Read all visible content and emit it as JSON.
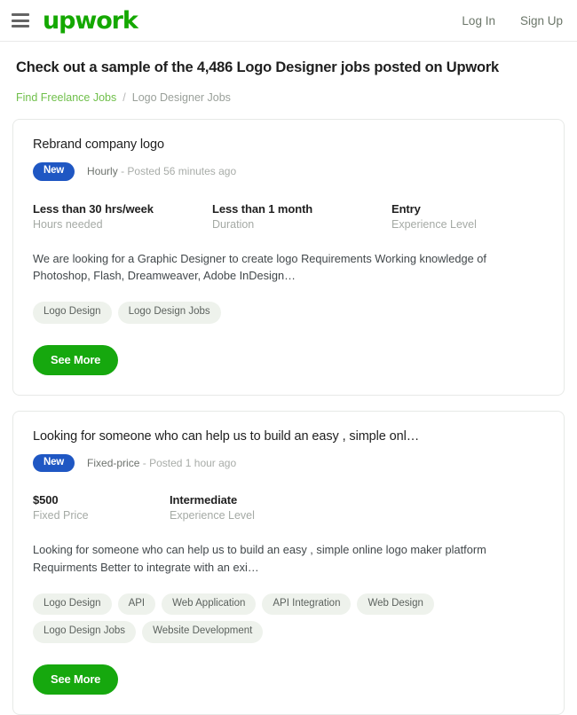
{
  "header": {
    "menu_icon": "hamburger-menu-icon",
    "brand": "upwork",
    "login_label": "Log In",
    "signup_label": "Sign Up"
  },
  "page": {
    "title": "Check out a sample of the 4,486 Logo Designer jobs posted on Upwork",
    "breadcrumb": {
      "parent": "Find Freelance Jobs",
      "separator": "/",
      "current": "Logo Designer Jobs"
    }
  },
  "jobs": [
    {
      "title": "Rebrand company logo",
      "badge": "New",
      "payment_type": "Hourly",
      "posted": "- Posted 56 minutes ago",
      "stats": [
        {
          "value": "Less than 30 hrs/week",
          "label": "Hours needed"
        },
        {
          "value": "Less than 1 month",
          "label": "Duration"
        },
        {
          "value": "Entry",
          "label": "Experience Level"
        }
      ],
      "description": "We are looking for a Graphic Designer to create logo Requirements Working knowledge of Photoshop, Flash, Dreamweaver, Adobe InDesign…",
      "tags": [
        "Logo Design",
        "Logo Design Jobs"
      ],
      "see_more_label": "See More"
    },
    {
      "title": "Looking for someone who can help us to build an easy , simple onl…",
      "badge": "New",
      "payment_type": "Fixed-price",
      "posted": "- Posted 1 hour ago",
      "stats": [
        {
          "value": "$500",
          "label": "Fixed Price"
        },
        {
          "value": "Intermediate",
          "label": "Experience Level"
        }
      ],
      "description": "Looking for someone who can help us to build an easy , simple online logo maker platform Requirments Better to integrate with an exi…",
      "tags": [
        "Logo Design",
        "API",
        "Web Application",
        "API Integration",
        "Web Design",
        "Logo Design Jobs",
        "Website Development"
      ],
      "see_more_label": "See More"
    }
  ],
  "colors": {
    "brand_green": "#14a800",
    "button_green": "#16a80e",
    "badge_blue": "#1f57c3",
    "tag_bg": "#eef2ec",
    "breadcrumb_link": "#6fbf4a"
  }
}
